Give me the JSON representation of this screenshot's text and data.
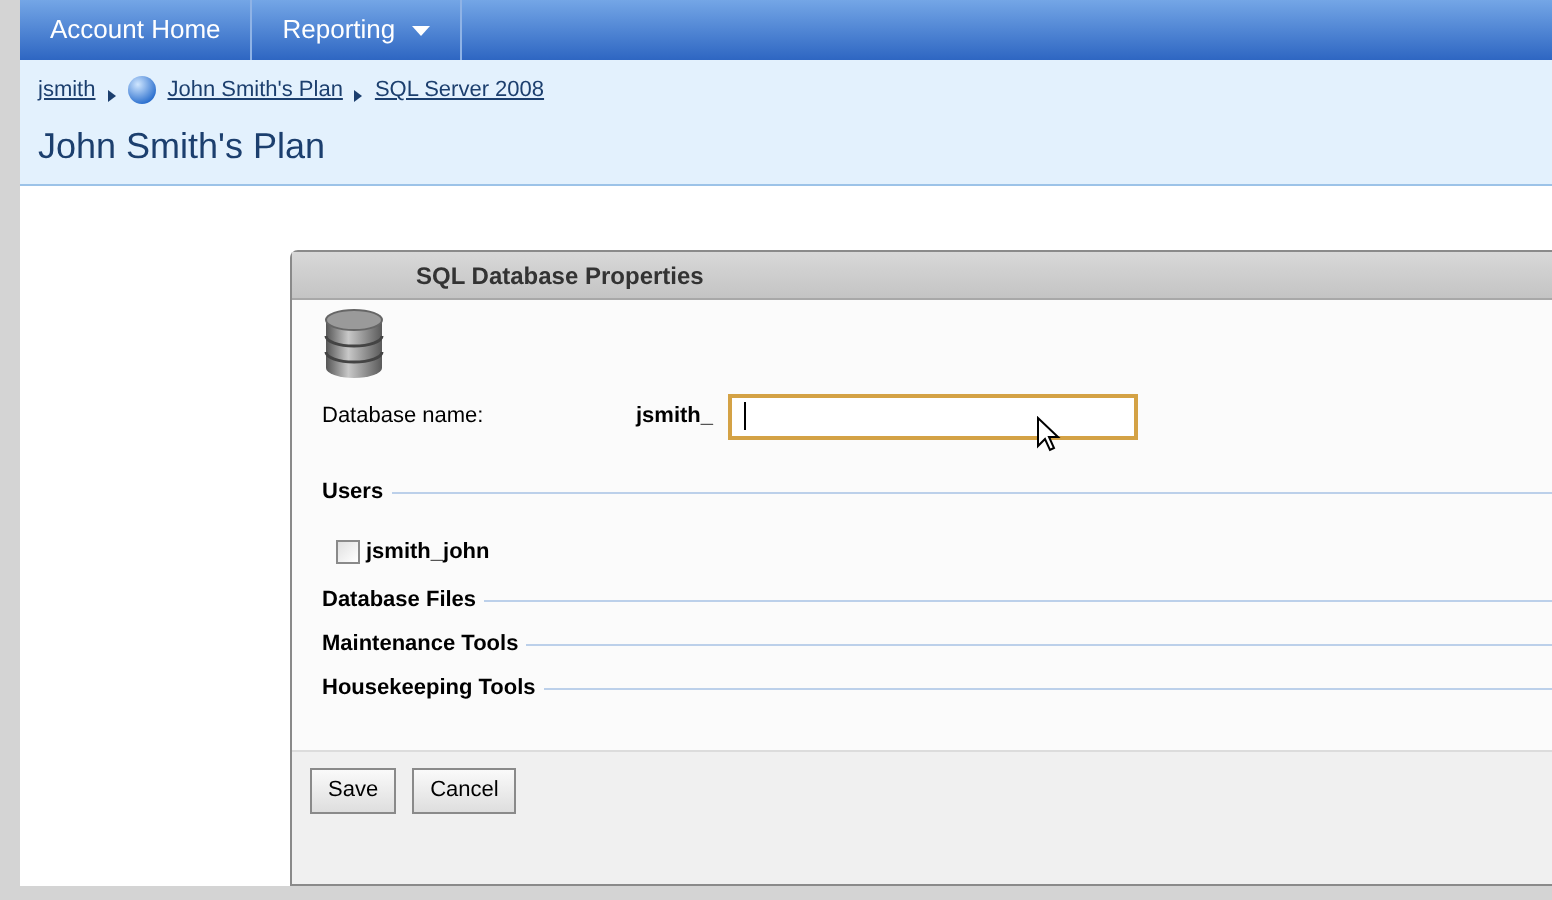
{
  "nav": {
    "items": [
      {
        "label": "Account Home",
        "dropdown": false
      },
      {
        "label": "Reporting",
        "dropdown": true
      }
    ]
  },
  "breadcrumb": [
    {
      "label": "jsmith",
      "icon": false
    },
    {
      "label": "John Smith's Plan",
      "icon": true
    },
    {
      "label": "SQL Server 2008",
      "icon": false
    }
  ],
  "page_title": "John Smith's Plan",
  "dialog": {
    "title": "SQL Database Properties",
    "database_name": {
      "label": "Database name:",
      "prefix": "jsmith_",
      "focused": true
    },
    "sections": [
      {
        "title": "Users",
        "users": [
          {
            "label": "jsmith_john",
            "checked": false
          }
        ]
      },
      {
        "title": "Database Files"
      },
      {
        "title": "Maintenance Tools"
      },
      {
        "title": "Housekeeping Tools"
      }
    ],
    "buttons": [
      "Save",
      "Cancel"
    ]
  }
}
